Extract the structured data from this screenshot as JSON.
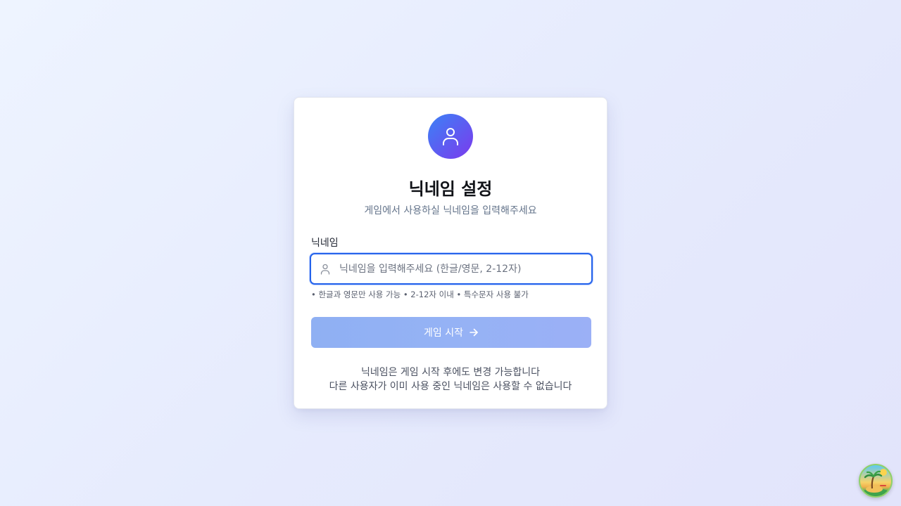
{
  "header": {
    "avatar_icon": "user-icon",
    "title": "닉네임 설정",
    "subtitle": "게임에서 사용하실 닉네임을 입력해주세요"
  },
  "form": {
    "label": "닉네임",
    "input_value": "",
    "input_placeholder": "닉네임을 입력해주세요 (한글/영문, 2-12자)",
    "input_icon": "user-icon",
    "hint": "• 한글과 영문만 사용 가능 • 2-12자 이내 • 특수문자 사용 불가",
    "submit_label": "게임 시작",
    "submit_icon": "arrow-right-icon",
    "submit_enabled": false
  },
  "footer": {
    "line1": "닉네임은 게임 시작 후에도 변경 가능합니다",
    "line2": "다른 사용자가 이미 사용 중인 닉네임은 사용할 수 없습니다"
  },
  "corner_badge": {
    "icon": "beach-island-icon"
  },
  "colors": {
    "accent": "#2563eb",
    "avatar_gradient_start": "#3b82f6",
    "avatar_gradient_end": "#7c3aed",
    "button_disabled": "#93b1f4"
  }
}
